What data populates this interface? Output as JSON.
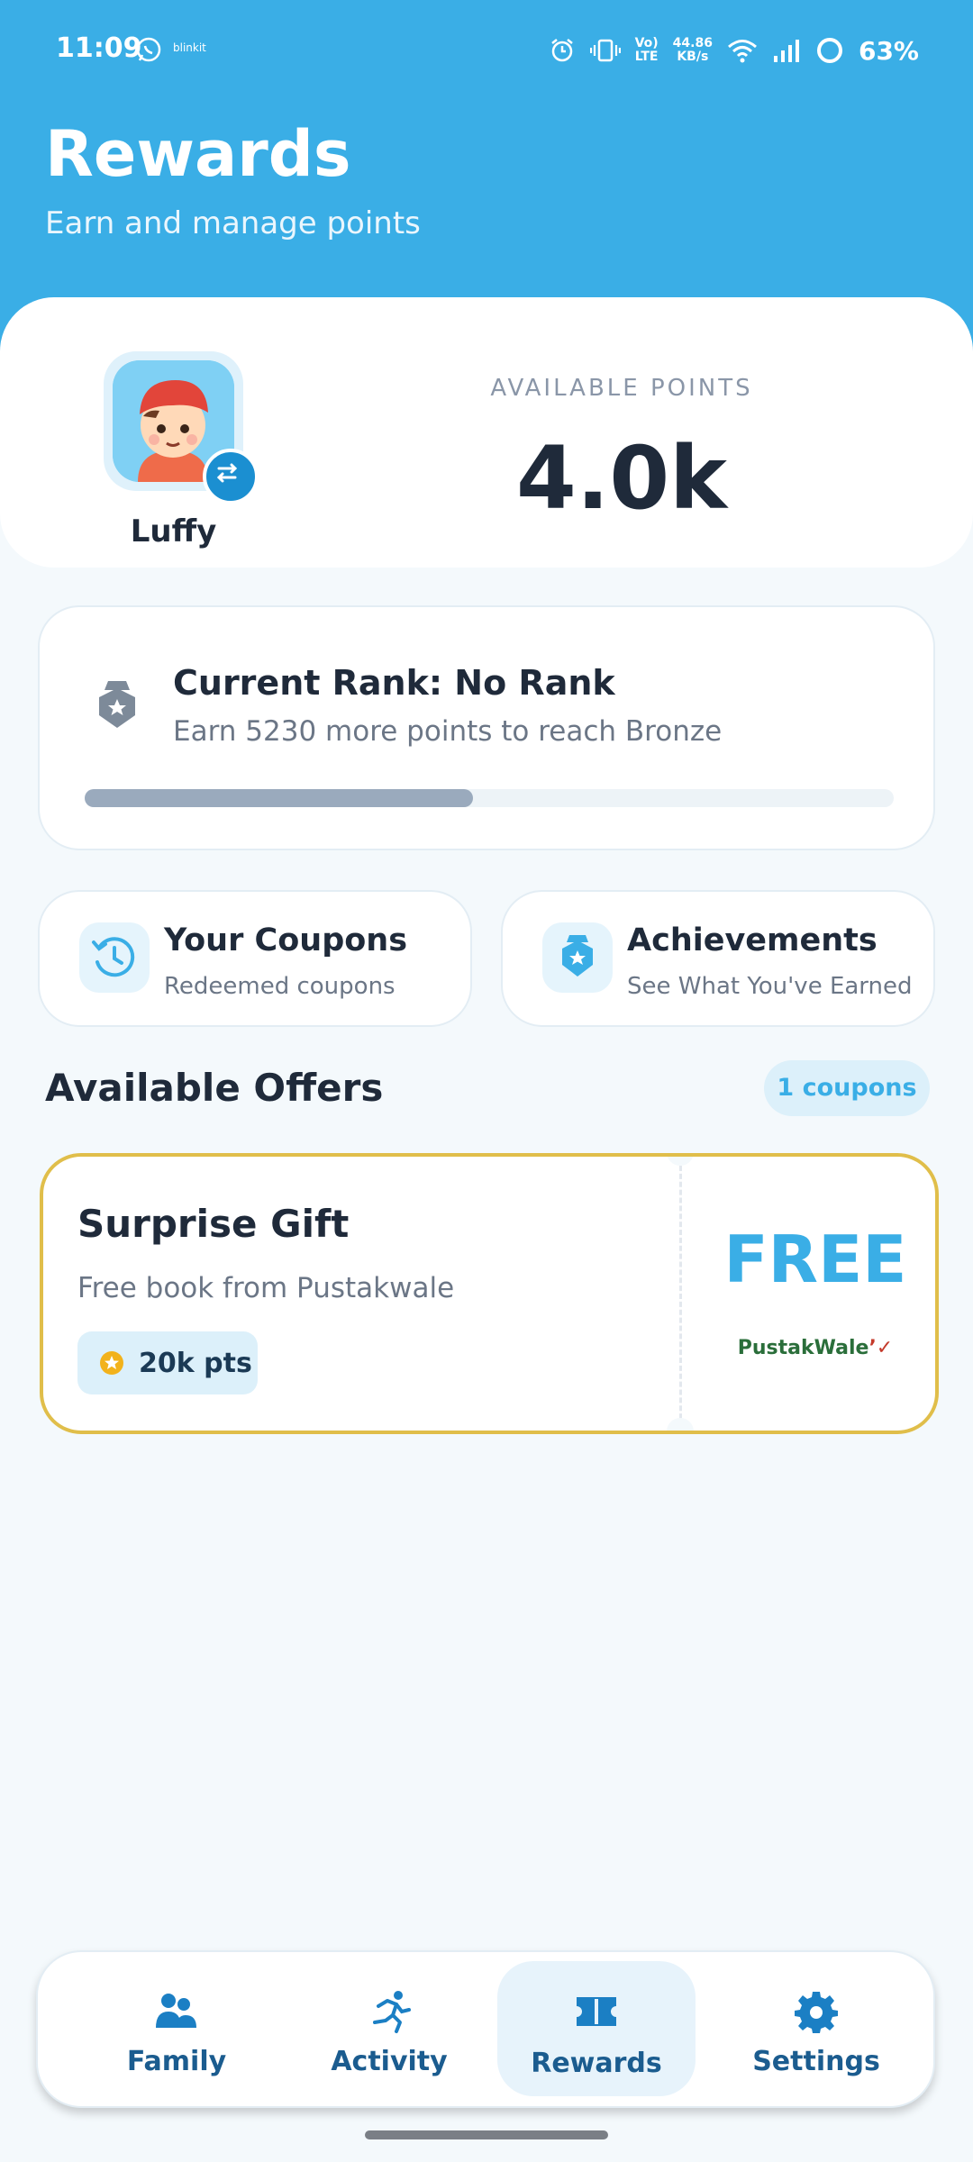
{
  "status_bar": {
    "time": "11:09",
    "notification_app": "blinkit",
    "network_speed_top": "44.86",
    "network_speed_bottom": "KB/s",
    "lte_top": "Vo)",
    "lte_bottom": "LTE",
    "battery": "63%"
  },
  "header": {
    "title": "Rewards",
    "subtitle": "Earn and manage points"
  },
  "profile": {
    "name": "Luffy",
    "points_label": "AVAILABLE POINTS",
    "points_value": "4.0k"
  },
  "rank": {
    "title": "Current Rank: No Rank",
    "subtitle": "Earn 5230 more points to reach Bronze",
    "progress": 0.48
  },
  "quick_links": [
    {
      "title": "Your Coupons",
      "subtitle": "Redeemed coupons",
      "icon": "history-icon"
    },
    {
      "title": "Achievements",
      "subtitle": "See What You've Earned",
      "icon": "medal-icon"
    }
  ],
  "offers": {
    "title": "Available Offers",
    "count_label": "1 coupons",
    "items": [
      {
        "title": "Surprise Gift",
        "description": "Free book from Pustakwale",
        "points": "20k pts",
        "price_label": "FREE",
        "brand_main": "PustakWale",
        "brand_mark": "’✓"
      }
    ]
  },
  "nav": {
    "items": [
      {
        "label": "Family",
        "icon": "family-icon"
      },
      {
        "label": "Activity",
        "icon": "running-icon"
      },
      {
        "label": "Rewards",
        "icon": "ticket-icon",
        "active": true
      },
      {
        "label": "Settings",
        "icon": "gear-icon"
      }
    ]
  },
  "colors": {
    "header_blue": "#3aaee6",
    "nav_text": "#1b5c8f",
    "offer_border": "#e0be4a",
    "background": "#f4f9fc"
  }
}
